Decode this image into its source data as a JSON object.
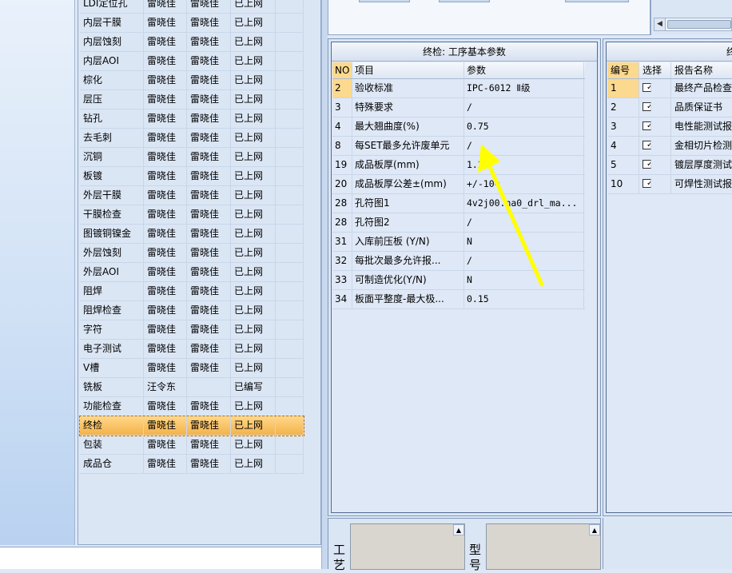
{
  "processes": [
    {
      "name": "LDI定位孔",
      "maker": "雷晓佳",
      "checker": "雷晓佳",
      "status": "已上网"
    },
    {
      "name": "内层干膜",
      "maker": "雷晓佳",
      "checker": "雷晓佳",
      "status": "已上网"
    },
    {
      "name": "内层蚀刻",
      "maker": "雷晓佳",
      "checker": "雷晓佳",
      "status": "已上网"
    },
    {
      "name": "内层AOI",
      "maker": "雷晓佳",
      "checker": "雷晓佳",
      "status": "已上网"
    },
    {
      "name": "棕化",
      "maker": "雷晓佳",
      "checker": "雷晓佳",
      "status": "已上网"
    },
    {
      "name": "层压",
      "maker": "雷晓佳",
      "checker": "雷晓佳",
      "status": "已上网"
    },
    {
      "name": "钻孔",
      "maker": "雷晓佳",
      "checker": "雷晓佳",
      "status": "已上网"
    },
    {
      "name": "去毛刺",
      "maker": "雷晓佳",
      "checker": "雷晓佳",
      "status": "已上网"
    },
    {
      "name": "沉铜",
      "maker": "雷晓佳",
      "checker": "雷晓佳",
      "status": "已上网"
    },
    {
      "name": "板镀",
      "maker": "雷晓佳",
      "checker": "雷晓佳",
      "status": "已上网"
    },
    {
      "name": "外层干膜",
      "maker": "雷晓佳",
      "checker": "雷晓佳",
      "status": "已上网"
    },
    {
      "name": "干膜检查",
      "maker": "雷晓佳",
      "checker": "雷晓佳",
      "status": "已上网"
    },
    {
      "name": "图镀铜镍金",
      "maker": "雷晓佳",
      "checker": "雷晓佳",
      "status": "已上网"
    },
    {
      "name": "外层蚀刻",
      "maker": "雷晓佳",
      "checker": "雷晓佳",
      "status": "已上网"
    },
    {
      "name": "外层AOI",
      "maker": "雷晓佳",
      "checker": "雷晓佳",
      "status": "已上网"
    },
    {
      "name": "阻焊",
      "maker": "雷晓佳",
      "checker": "雷晓佳",
      "status": "已上网"
    },
    {
      "name": "阻焊检查",
      "maker": "雷晓佳",
      "checker": "雷晓佳",
      "status": "已上网"
    },
    {
      "name": "字符",
      "maker": "雷晓佳",
      "checker": "雷晓佳",
      "status": "已上网"
    },
    {
      "name": "电子测试",
      "maker": "雷晓佳",
      "checker": "雷晓佳",
      "status": "已上网"
    },
    {
      "name": "V槽",
      "maker": "雷晓佳",
      "checker": "雷晓佳",
      "status": "已上网"
    },
    {
      "name": "铣板",
      "maker": "汪令东",
      "checker": "",
      "status": "已编写"
    },
    {
      "name": "功能检查",
      "maker": "雷晓佳",
      "checker": "雷晓佳",
      "status": "已上网"
    },
    {
      "name": "终检",
      "maker": "雷晓佳",
      "checker": "雷晓佳",
      "status": "已上网",
      "selected": true
    },
    {
      "name": "包装",
      "maker": "雷晓佳",
      "checker": "雷晓佳",
      "status": "已上网"
    },
    {
      "name": "成品仓",
      "maker": "雷晓佳",
      "checker": "雷晓佳",
      "status": "已上网"
    }
  ],
  "param_panel": {
    "title": "终检: 工序基本参数",
    "headers": {
      "no": "NO",
      "item": "项目",
      "value": "参数"
    },
    "rows": [
      {
        "no": "2",
        "item": "验收标准",
        "value": "IPC-6012 Ⅱ级",
        "selected": true
      },
      {
        "no": "3",
        "item": "特殊要求",
        "value": "/"
      },
      {
        "no": "4",
        "item": "最大翘曲度(%)",
        "value": "0.75"
      },
      {
        "no": "8",
        "item": "每SET最多允许废单元",
        "value": "/"
      },
      {
        "no": "19",
        "item": "成品板厚(mm)",
        "value": "1.2"
      },
      {
        "no": "20",
        "item": "成品板厚公差±(mm)",
        "value": "+/-10%"
      },
      {
        "no": "28",
        "item": "孔符图1",
        "value": "4v2j00.na0_drl_ma..."
      },
      {
        "no": "28",
        "item": "孔符图2",
        "value": "/"
      },
      {
        "no": "31",
        "item": "入库前压板 (Y/N)",
        "value": "N"
      },
      {
        "no": "32",
        "item": "每批次最多允许报...",
        "value": "/"
      },
      {
        "no": "33",
        "item": "可制造优化(Y/N)",
        "value": "N"
      },
      {
        "no": "34",
        "item": "板面平整度-最大极...",
        "value": "0.15"
      }
    ]
  },
  "report_panel": {
    "title": "终",
    "headers": {
      "id": "编号",
      "select": "选择",
      "name": "报告名称"
    },
    "rows": [
      {
        "id": "1",
        "checked": "✓",
        "name": "最终产品检查",
        "selected": true
      },
      {
        "id": "2",
        "checked": "✓",
        "name": "品质保证书"
      },
      {
        "id": "3",
        "checked": "✓",
        "name": "电性能测试报"
      },
      {
        "id": "4",
        "checked": "✓",
        "name": "金相切片检测"
      },
      {
        "id": "5",
        "checked": "✓",
        "name": "镀层厚度测试"
      },
      {
        "id": "10",
        "checked": "✓",
        "name": "可焊性测试报"
      }
    ]
  },
  "bottom": {
    "left_label": "工艺",
    "right_label": "型号"
  },
  "scroll": {
    "left_arrow": "◀",
    "up_arrow": "▲"
  },
  "colors": {
    "selected_row": "#f4b24a",
    "header_highlight": "#fbd98f",
    "panel_bg": "#dfe8f6",
    "annotation_arrow": "#ffff00"
  }
}
